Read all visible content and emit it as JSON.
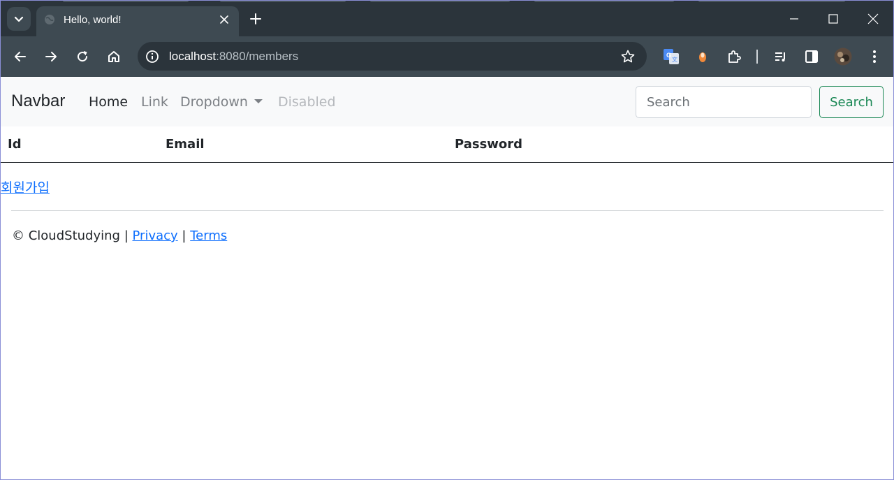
{
  "browser": {
    "tab": {
      "title": "Hello, world!"
    },
    "omnibox": {
      "host": "localhost",
      "path": ":8080/members"
    }
  },
  "navbar": {
    "brand": "Navbar",
    "links": [
      {
        "label": "Home",
        "state": "active"
      },
      {
        "label": "Link",
        "state": "normal"
      },
      {
        "label": "Dropdown",
        "state": "dropdown"
      },
      {
        "label": "Disabled",
        "state": "disabled"
      }
    ],
    "search": {
      "placeholder": "Search",
      "value": "",
      "button_label": "Search"
    }
  },
  "table": {
    "headers": [
      "Id",
      "Email",
      "Password"
    ],
    "rows": []
  },
  "signup_link": "회원가입",
  "footer": {
    "copyright": "© CloudStudying",
    "separator": "|",
    "privacy": "Privacy",
    "terms": "Terms"
  },
  "colors": {
    "tabstrip": "#2b343b",
    "toolbar": "#3e4a52",
    "link": "#0d6efd",
    "success": "#198754",
    "navbar_bg": "#f8f9fa"
  },
  "icons": [
    "tab-search-icon",
    "globe-icon",
    "close-icon",
    "plus-icon",
    "minimize-icon",
    "maximize-icon",
    "back-arrow-icon",
    "forward-arrow-icon",
    "reload-icon",
    "home-icon",
    "info-icon",
    "star-icon",
    "translate-icon",
    "extension-orange-icon",
    "puzzle-icon",
    "media-queue-icon",
    "side-panel-icon",
    "profile-avatar",
    "more-vert-icon"
  ]
}
